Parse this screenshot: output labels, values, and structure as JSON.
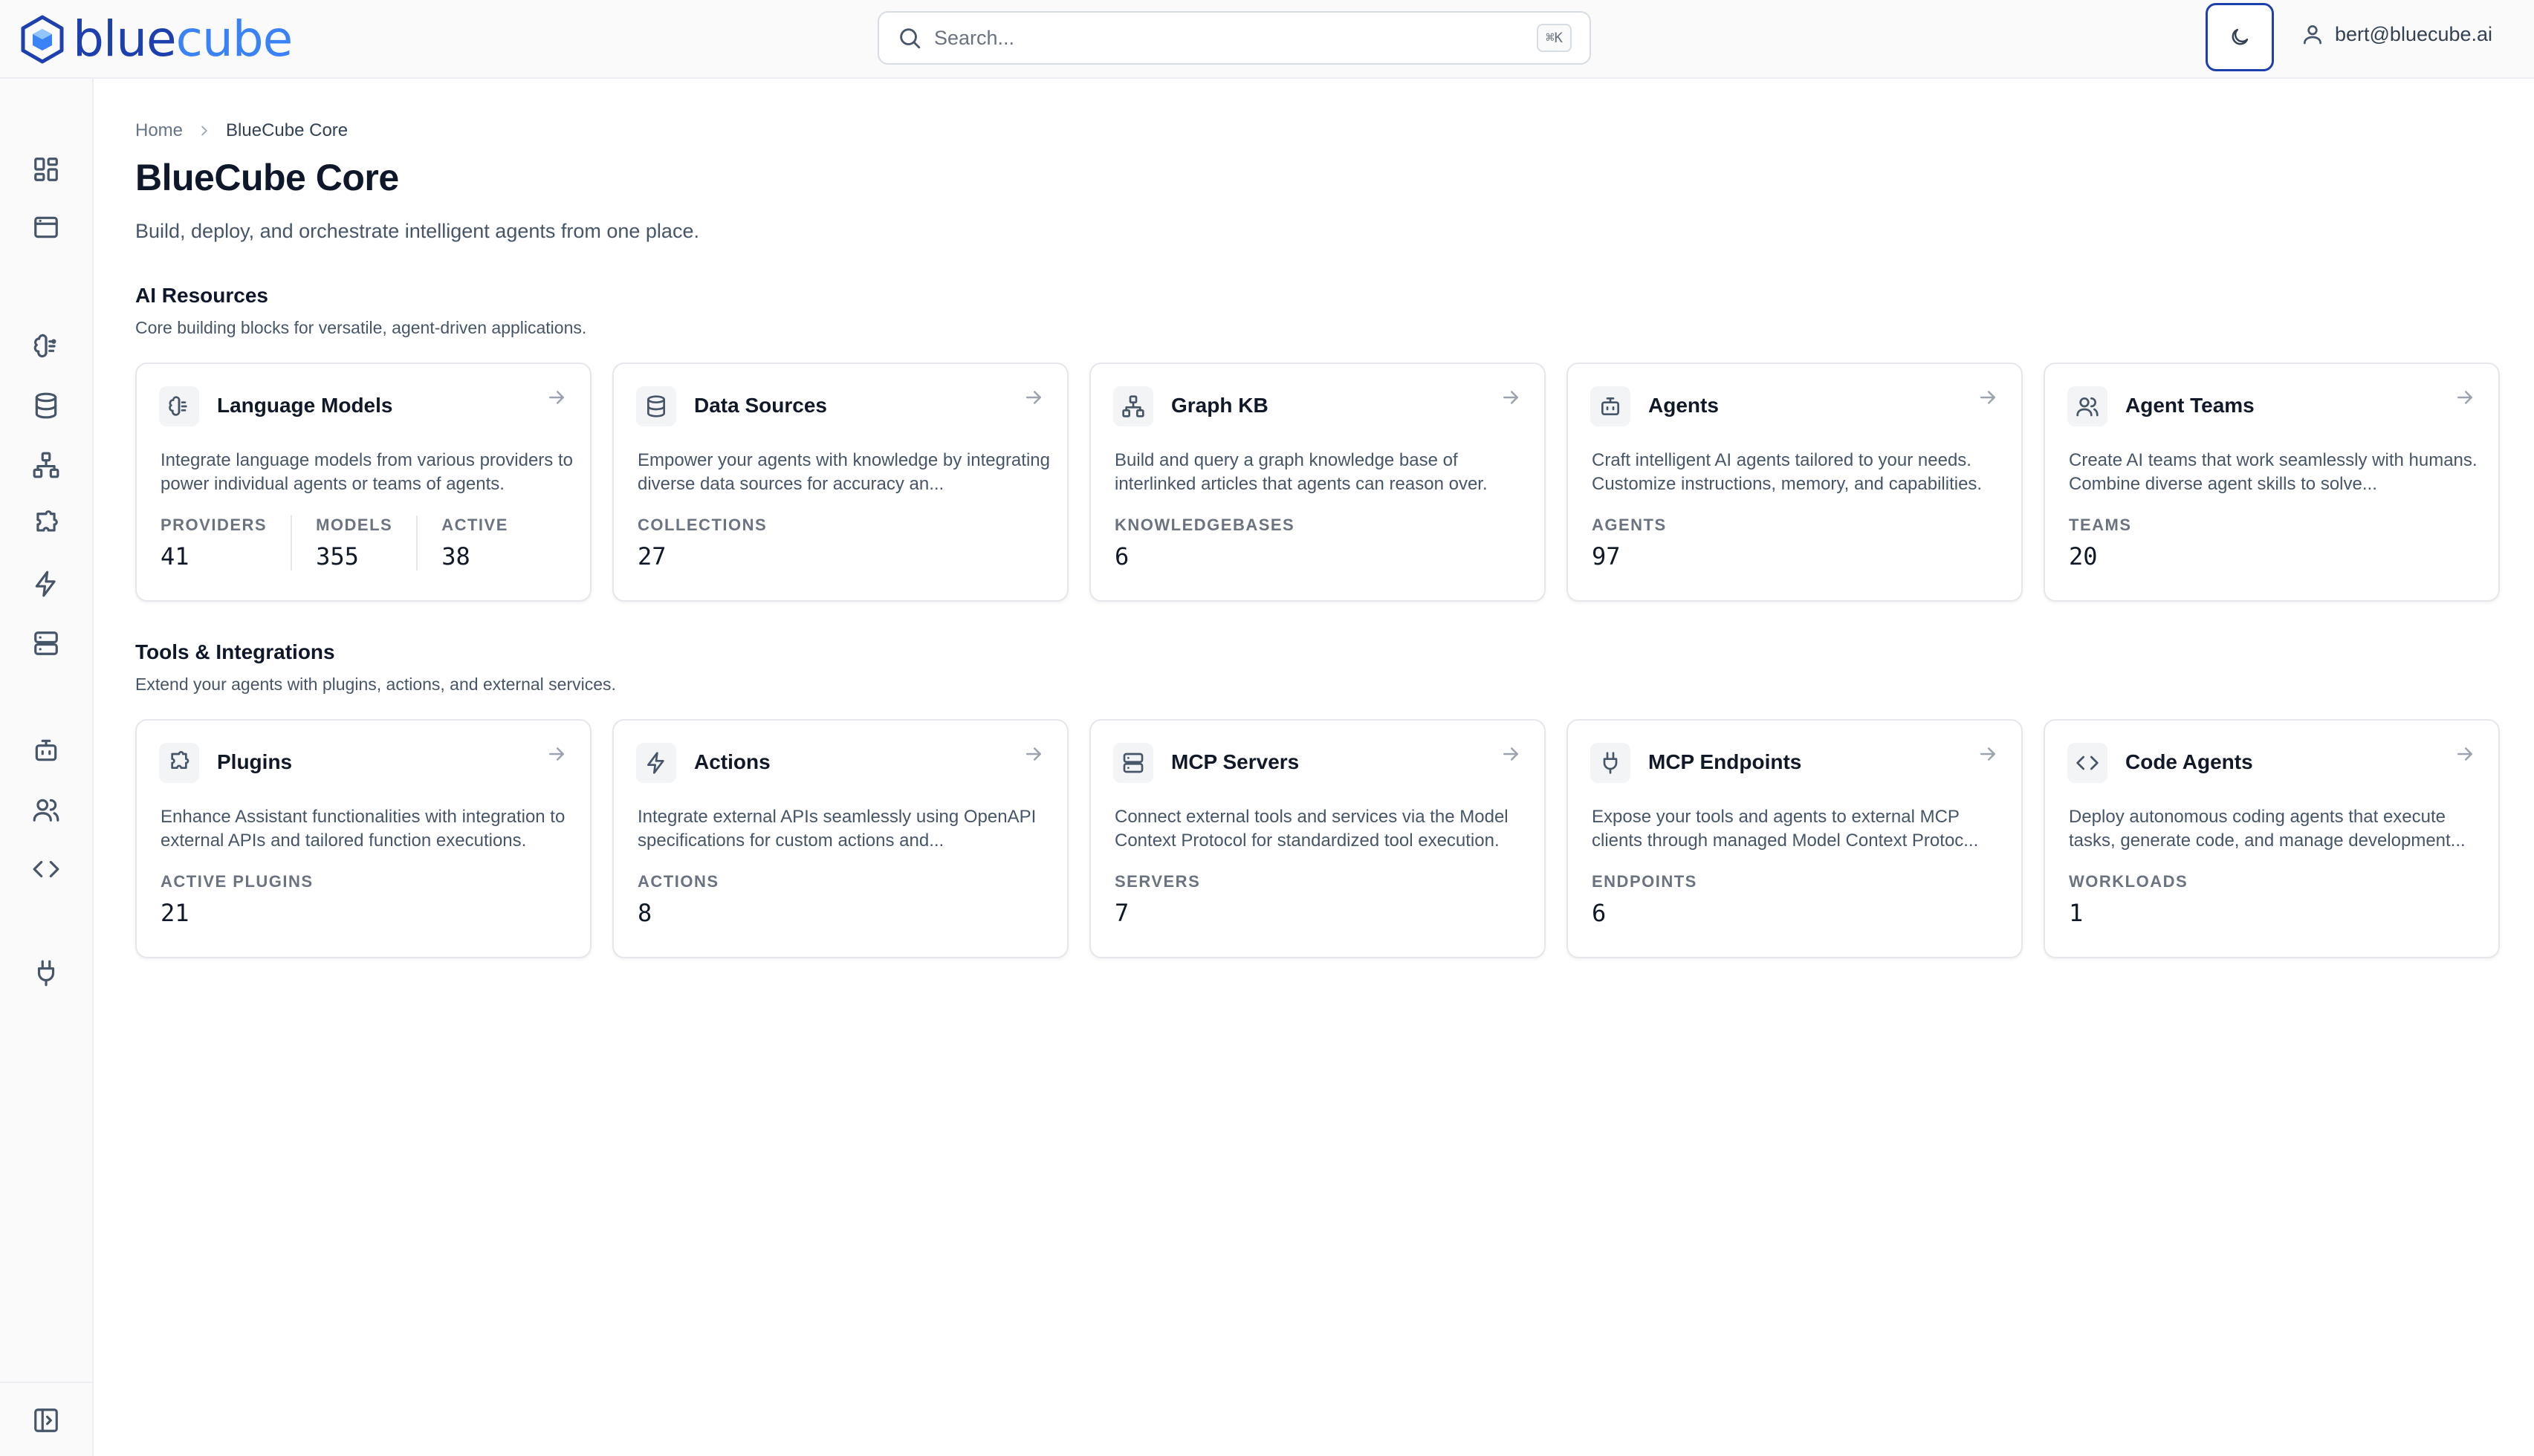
{
  "header": {
    "logo_text_a": "blue",
    "logo_text_b": "cube",
    "search_placeholder": "Search...",
    "search_shortcut": "⌘K",
    "user_email": "bert@bluecube.ai"
  },
  "sidebar": {
    "icons": [
      "dashboard-icon",
      "browser-window-icon",
      "brain-icon",
      "database-icon",
      "network-icon",
      "puzzle-icon",
      "zap-icon",
      "server-icon",
      "bot-icon",
      "users-icon",
      "code-icon",
      "plug-icon",
      "sidebar-toggle-icon"
    ]
  },
  "breadcrumb": {
    "home": "Home",
    "current": "BlueCube Core"
  },
  "page": {
    "title": "BlueCube Core",
    "subtitle": "Build, deploy, and orchestrate intelligent agents from one place."
  },
  "sections": [
    {
      "title": "AI Resources",
      "description": "Core building blocks for versatile, agent-driven applications.",
      "cards": [
        {
          "title": "Language Models",
          "icon": "brain-icon",
          "description": "Integrate language models from various providers to power individual agents or teams of agents.",
          "stats": [
            {
              "label": "PROVIDERS",
              "value": "41"
            },
            {
              "label": "MODELS",
              "value": "355"
            },
            {
              "label": "ACTIVE",
              "value": "38"
            }
          ]
        },
        {
          "title": "Data Sources",
          "icon": "database-icon",
          "description": "Empower your agents with knowledge by integrating diverse data sources for accuracy an...",
          "stats": [
            {
              "label": "COLLECTIONS",
              "value": "27"
            }
          ]
        },
        {
          "title": "Graph KB",
          "icon": "network-icon",
          "description": "Build and query a graph knowledge base of interlinked articles that agents can reason over.",
          "stats": [
            {
              "label": "KNOWLEDGEBASES",
              "value": "6"
            }
          ]
        },
        {
          "title": "Agents",
          "icon": "bot-icon",
          "description": "Craft intelligent AI agents tailored to your needs. Customize instructions, memory, and capabilities.",
          "stats": [
            {
              "label": "AGENTS",
              "value": "97"
            }
          ]
        },
        {
          "title": "Agent Teams",
          "icon": "users-icon",
          "description": "Create AI teams that work seamlessly with humans. Combine diverse agent skills to solve...",
          "stats": [
            {
              "label": "TEAMS",
              "value": "20"
            }
          ]
        }
      ]
    },
    {
      "title": "Tools & Integrations",
      "description": "Extend your agents with plugins, actions, and external services.",
      "cards": [
        {
          "title": "Plugins",
          "icon": "puzzle-icon",
          "description": "Enhance Assistant functionalities with integration to external APIs and tailored function executions.",
          "stats": [
            {
              "label": "ACTIVE PLUGINS",
              "value": "21"
            }
          ]
        },
        {
          "title": "Actions",
          "icon": "zap-icon",
          "description": "Integrate external APIs seamlessly using OpenAPI specifications for custom actions and...",
          "stats": [
            {
              "label": "ACTIONS",
              "value": "8"
            }
          ]
        },
        {
          "title": "MCP Servers",
          "icon": "server-icon",
          "description": "Connect external tools and services via the Model Context Protocol for standardized tool execution.",
          "stats": [
            {
              "label": "SERVERS",
              "value": "7"
            }
          ]
        },
        {
          "title": "MCP Endpoints",
          "icon": "plug-icon",
          "description": "Expose your tools and agents to external MCP clients through managed Model Context Protoc...",
          "stats": [
            {
              "label": "ENDPOINTS",
              "value": "6"
            }
          ]
        },
        {
          "title": "Code Agents",
          "icon": "code-icon",
          "description": "Deploy autonomous coding agents that execute tasks, generate code, and manage development...",
          "stats": [
            {
              "label": "WORKLOADS",
              "value": "1"
            }
          ]
        }
      ]
    }
  ],
  "colors": {
    "brand": "#1e40af",
    "brand_light": "#3b82f6",
    "text": "#0f172a",
    "muted": "#475569",
    "border": "#e5e7eb"
  }
}
